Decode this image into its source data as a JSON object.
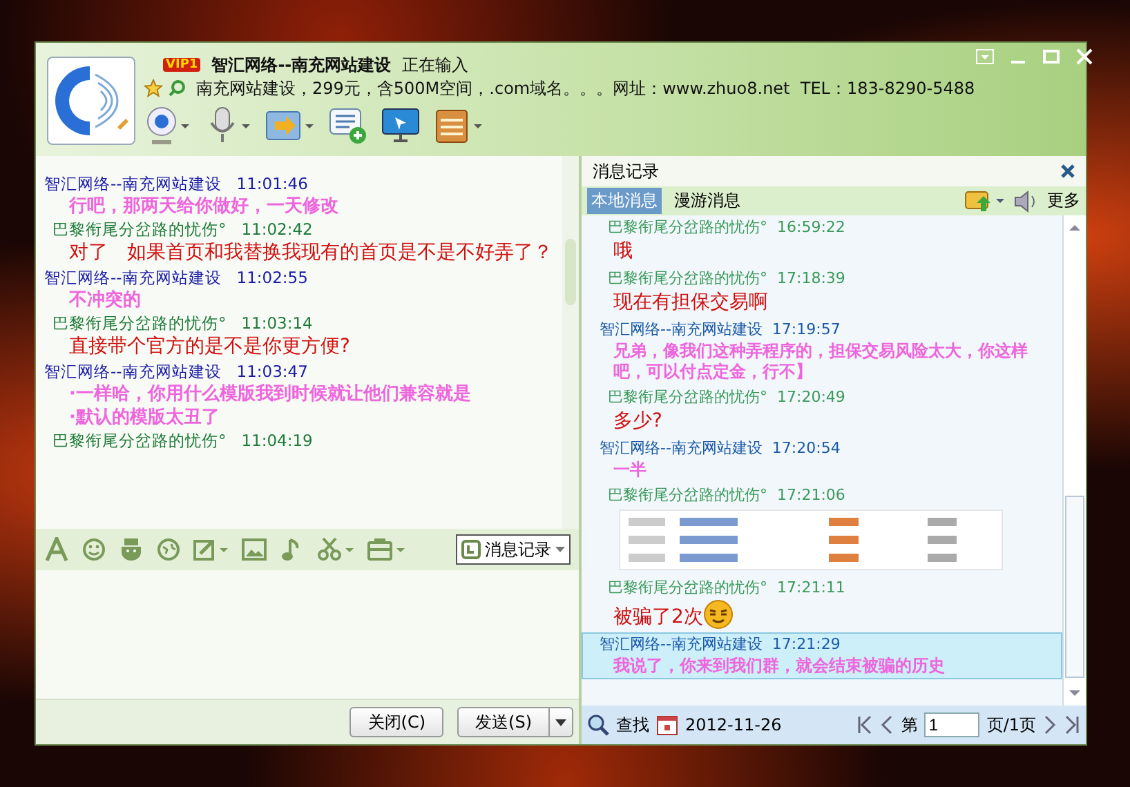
{
  "header": {
    "vip": "VIP1",
    "name": "智汇网络--南充网站建设",
    "status": "正在输入",
    "signature": "南充网站建设，299元，含500M空间，.com域名。。。网址：www.zhuo8.net  TEL：183-8290-5488"
  },
  "chat": {
    "messages": [
      {
        "kind": "sent",
        "sender": "智汇网络--南充网站建设",
        "time": "11:01:46",
        "lines": [
          "行吧，那两天给你做好，一天修改"
        ]
      },
      {
        "kind": "received",
        "sender": "巴黎衔尾分岔路的忧伤°",
        "time": "11:02:42",
        "lines": [
          "对了　如果首页和我替换我现有的首页是不是不好弄了？"
        ]
      },
      {
        "kind": "sent",
        "sender": "智汇网络--南充网站建设",
        "time": "11:02:55",
        "lines": [
          "不冲突的"
        ]
      },
      {
        "kind": "received",
        "sender": "巴黎衔尾分岔路的忧伤°",
        "time": "11:03:14",
        "lines": [
          "直接带个官方的是不是你更方便?"
        ]
      },
      {
        "kind": "sent",
        "sender": "智汇网络--南充网站建设",
        "time": "11:03:47",
        "lines": [
          "·一样哈，你用什么模版我到时候就让他们兼容就是",
          "·默认的模版太丑了"
        ]
      },
      {
        "kind": "received",
        "sender": "巴黎衔尾分岔路的忧伤°",
        "time": "11:04:19"
      }
    ]
  },
  "input_toolbar": {
    "history_button": "消息记录"
  },
  "buttons": {
    "close": "关闭(C)",
    "send": "发送(S)"
  },
  "history": {
    "title": "消息记录",
    "tabs": [
      {
        "label": "本地消息",
        "selected": true
      },
      {
        "label": "漫游消息",
        "selected": false
      }
    ],
    "more": "更多",
    "messages": [
      {
        "kind": "received",
        "sender": "巴黎衔尾分岔路的忧伤°",
        "time": "16:59:22",
        "text": "哦",
        "emoji": false,
        "selected": false
      },
      {
        "kind": "received",
        "sender": "巴黎衔尾分岔路的忧伤°",
        "time": "17:18:39",
        "text": "现在有担保交易啊",
        "emoji": false,
        "selected": false
      },
      {
        "kind": "sent",
        "sender": "智汇网络--南充网站建设",
        "time": "17:19:57",
        "text": "兄弟，像我们这种弄程序的，担保交易风险太大，你这样吧，可以付点定金，行不】",
        "emoji": false,
        "selected": false
      },
      {
        "kind": "received",
        "sender": "巴黎衔尾分岔路的忧伤°",
        "time": "17:20:49",
        "text": "多少?",
        "emoji": false,
        "selected": false
      },
      {
        "kind": "sent",
        "sender": "智汇网络--南充网站建设",
        "time": "17:20:54",
        "text": "一半",
        "emoji": false,
        "selected": false
      },
      {
        "kind": "received_image",
        "sender": "巴黎衔尾分岔路的忧伤°",
        "time": "17:21:06",
        "selected": false
      },
      {
        "kind": "received",
        "sender": "巴黎衔尾分岔路的忧伤°",
        "time": "17:21:11",
        "text": "被骗了2次",
        "emoji": true,
        "selected": false
      },
      {
        "kind": "sent",
        "sender": "智汇网络--南充网站建设",
        "time": "17:21:29",
        "text": "我说了，你来到我们群，就会结束被骗的历史",
        "emoji": false,
        "selected": true
      }
    ],
    "search": "查找",
    "date": "2012-11-26",
    "page_prefix": "第",
    "page": "1",
    "page_suffix": "页/1页"
  }
}
